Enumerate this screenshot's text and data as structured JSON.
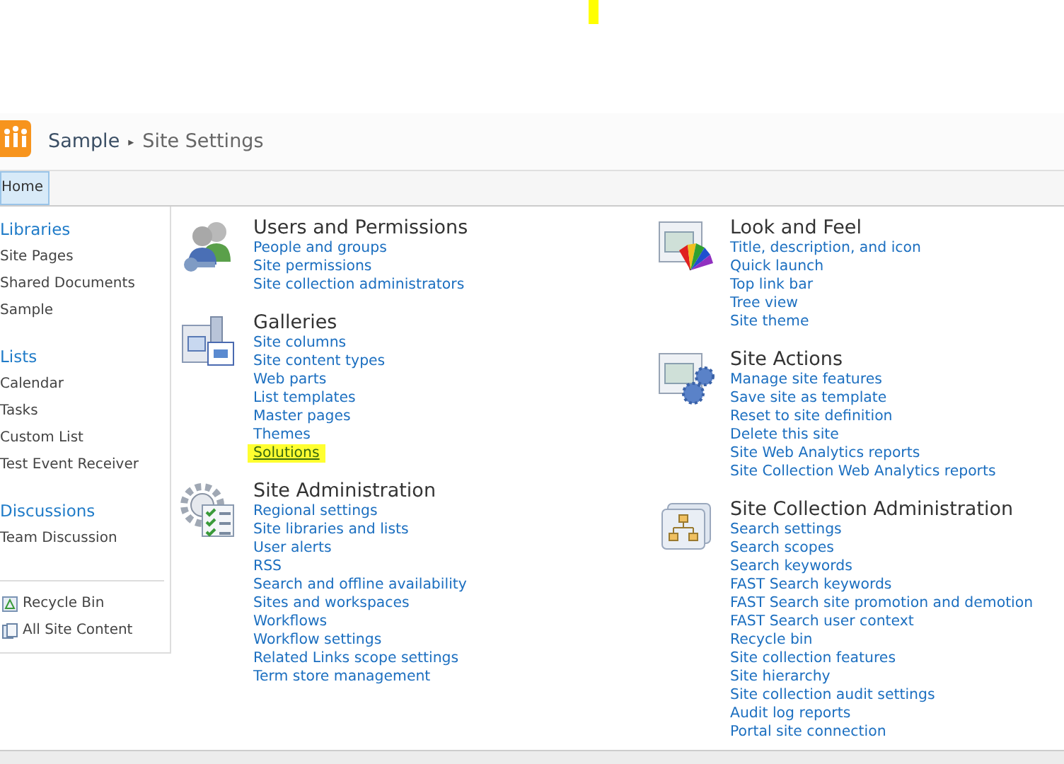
{
  "breadcrumb": {
    "site": "Sample",
    "separator": "▸",
    "page": "Site Settings"
  },
  "tabs": [
    {
      "label": "Home",
      "selected": true
    }
  ],
  "sidebar": {
    "groups": [
      {
        "heading": "Libraries",
        "items": [
          "Site Pages",
          "Shared Documents",
          "Sample"
        ]
      },
      {
        "heading": "Lists",
        "items": [
          "Calendar",
          "Tasks",
          "Custom List",
          "Test Event Receiver"
        ]
      },
      {
        "heading": "Discussions",
        "items": [
          "Team Discussion"
        ]
      }
    ],
    "footer": [
      {
        "kind": "recycle",
        "label": "Recycle Bin"
      },
      {
        "kind": "content",
        "label": "All Site Content"
      }
    ]
  },
  "columns": [
    [
      {
        "kind": "users",
        "title": "Users and Permissions",
        "links": [
          {
            "text": "People and groups",
            "highlighted": false
          },
          {
            "text": "Site permissions",
            "highlighted": false
          },
          {
            "text": "Site collection administrators",
            "highlighted": false
          }
        ]
      },
      {
        "kind": "galleries",
        "title": "Galleries",
        "links": [
          {
            "text": "Site columns",
            "highlighted": false
          },
          {
            "text": "Site content types",
            "highlighted": false
          },
          {
            "text": "Web parts",
            "highlighted": false
          },
          {
            "text": "List templates",
            "highlighted": false
          },
          {
            "text": "Master pages",
            "highlighted": false
          },
          {
            "text": "Themes",
            "highlighted": false
          },
          {
            "text": "Solutions",
            "highlighted": true
          }
        ]
      },
      {
        "kind": "admin",
        "title": "Site Administration",
        "links": [
          {
            "text": "Regional settings",
            "highlighted": false
          },
          {
            "text": "Site libraries and lists",
            "highlighted": false
          },
          {
            "text": "User alerts",
            "highlighted": false
          },
          {
            "text": "RSS",
            "highlighted": false
          },
          {
            "text": "Search and offline availability",
            "highlighted": false
          },
          {
            "text": "Sites and workspaces",
            "highlighted": false
          },
          {
            "text": "Workflows",
            "highlighted": false
          },
          {
            "text": "Workflow settings",
            "highlighted": false
          },
          {
            "text": "Related Links scope settings",
            "highlighted": false
          },
          {
            "text": "Term store management",
            "highlighted": false
          }
        ]
      }
    ],
    [
      {
        "kind": "look",
        "title": "Look and Feel",
        "links": [
          {
            "text": "Title, description, and icon",
            "highlighted": false
          },
          {
            "text": "Quick launch",
            "highlighted": false
          },
          {
            "text": "Top link bar",
            "highlighted": false
          },
          {
            "text": "Tree view",
            "highlighted": false
          },
          {
            "text": "Site theme",
            "highlighted": false
          }
        ]
      },
      {
        "kind": "actions",
        "title": "Site Actions",
        "links": [
          {
            "text": "Manage site features",
            "highlighted": false
          },
          {
            "text": "Save site as template",
            "highlighted": false
          },
          {
            "text": "Reset to site definition",
            "highlighted": false
          },
          {
            "text": "Delete this site",
            "highlighted": false
          },
          {
            "text": "Site Web Analytics reports",
            "highlighted": false
          },
          {
            "text": "Site Collection Web Analytics reports",
            "highlighted": false
          }
        ]
      },
      {
        "kind": "collection",
        "title": "Site Collection Administration",
        "links": [
          {
            "text": "Search settings",
            "highlighted": false
          },
          {
            "text": "Search scopes",
            "highlighted": false
          },
          {
            "text": "Search keywords",
            "highlighted": false
          },
          {
            "text": "FAST Search keywords",
            "highlighted": false
          },
          {
            "text": "FAST Search site promotion and demotion",
            "highlighted": false
          },
          {
            "text": "FAST Search user context",
            "highlighted": false
          },
          {
            "text": "Recycle bin",
            "highlighted": false
          },
          {
            "text": "Site collection features",
            "highlighted": false
          },
          {
            "text": "Site hierarchy",
            "highlighted": false
          },
          {
            "text": "Site collection audit settings",
            "highlighted": false
          },
          {
            "text": "Audit log reports",
            "highlighted": false
          },
          {
            "text": "Portal site connection",
            "highlighted": false
          }
        ]
      }
    ]
  ]
}
